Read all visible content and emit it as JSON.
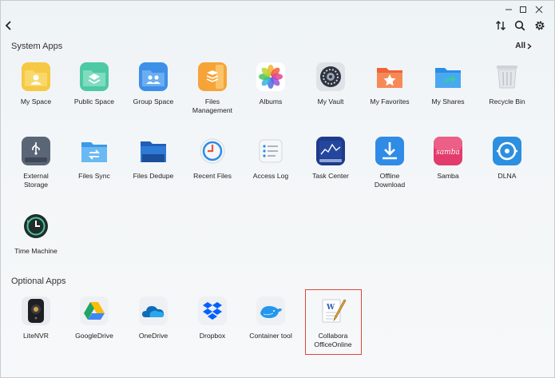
{
  "header": {
    "back_icon": "chevron-left-icon",
    "window_controls": [
      "minimize-icon",
      "maximize-icon",
      "close-icon"
    ],
    "toolbar": [
      "sort-icon",
      "search-icon",
      "gear-icon"
    ]
  },
  "system_apps": {
    "title": "System Apps",
    "all_label": "All",
    "items": [
      {
        "label": "My Space",
        "icon": "folder-user-icon"
      },
      {
        "label": "Public Space",
        "icon": "folder-layers-icon"
      },
      {
        "label": "Group Space",
        "icon": "folder-group-icon"
      },
      {
        "label": "Files\nManagement",
        "icon": "files-stack-icon"
      },
      {
        "label": "Albums",
        "icon": "albums-flower-icon"
      },
      {
        "label": "My Vault",
        "icon": "vault-icon"
      },
      {
        "label": "My Favorites",
        "icon": "folder-star-icon"
      },
      {
        "label": "My Shares",
        "icon": "folder-share-icon"
      },
      {
        "label": "Recycle Bin",
        "icon": "trash-icon"
      },
      {
        "label": "External\nStorage",
        "icon": "usb-drive-icon"
      },
      {
        "label": "Files Sync",
        "icon": "sync-folder-icon"
      },
      {
        "label": "Files Dedupe",
        "icon": "folder-dedupe-icon"
      },
      {
        "label": "Recent Files",
        "icon": "clock-icon"
      },
      {
        "label": "Access Log",
        "icon": "log-list-icon"
      },
      {
        "label": "Task Center",
        "icon": "task-chart-icon"
      },
      {
        "label": "Offline\nDownload",
        "icon": "download-icon"
      },
      {
        "label": "Samba",
        "icon": "samba-icon"
      },
      {
        "label": "DLNA",
        "icon": "dlna-icon"
      },
      {
        "label": "Time Machine",
        "icon": "time-machine-icon"
      }
    ]
  },
  "optional_apps": {
    "title": "Optional Apps",
    "items": [
      {
        "label": "LiteNVR",
        "icon": "camera-icon"
      },
      {
        "label": "GoogleDrive",
        "icon": "google-drive-icon"
      },
      {
        "label": "OneDrive",
        "icon": "onedrive-icon"
      },
      {
        "label": "Dropbox",
        "icon": "dropbox-icon"
      },
      {
        "label": "Container tool",
        "icon": "container-whale-icon"
      },
      {
        "label": "Collabora\nOfficeOnline",
        "icon": "collabora-document-icon"
      }
    ]
  },
  "colors": {
    "highlight": "#e0453a",
    "accent_blue": "#2f8be6"
  }
}
